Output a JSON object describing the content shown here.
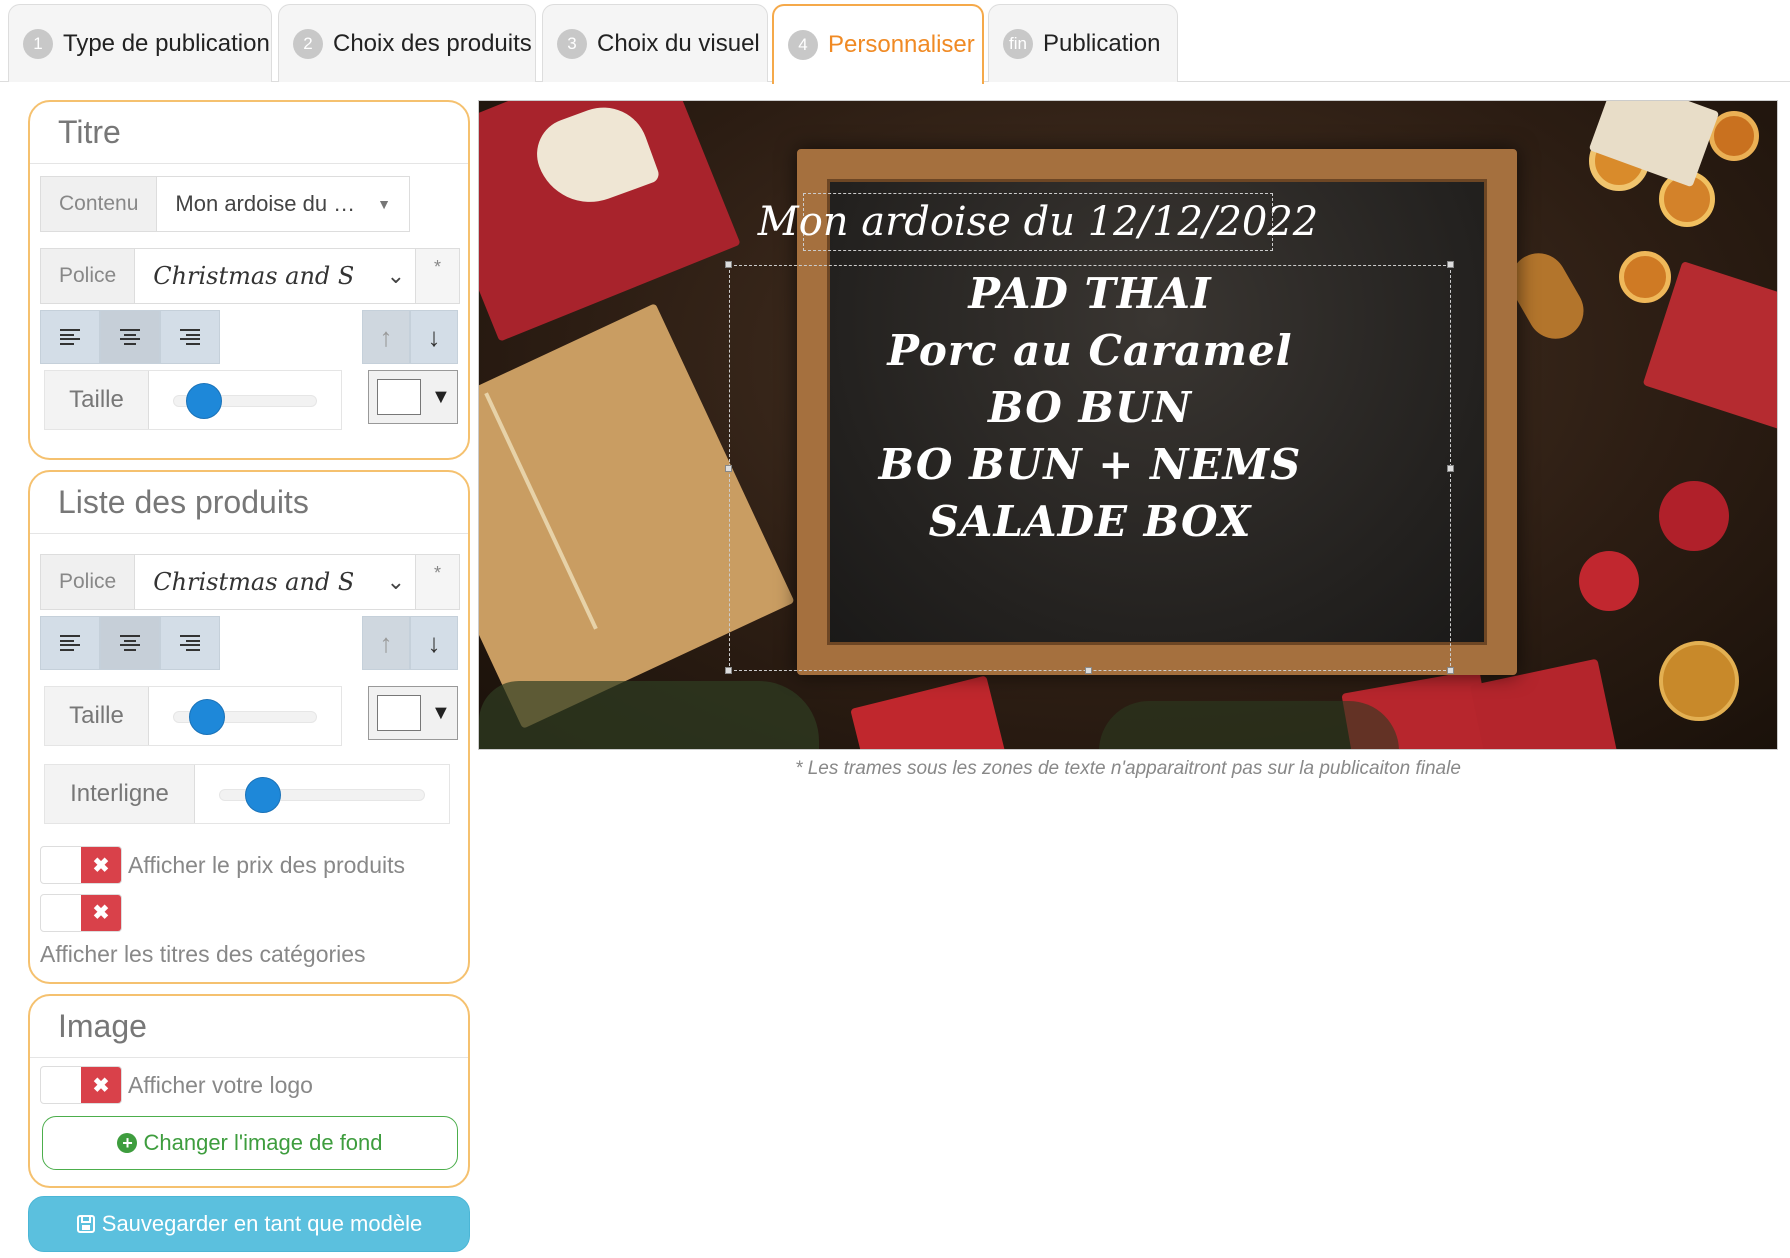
{
  "tabs": [
    {
      "num": "1",
      "label": "Type de publication"
    },
    {
      "num": "2",
      "label": "Choix des produits"
    },
    {
      "num": "3",
      "label": "Choix du visuel"
    },
    {
      "num": "4",
      "label": "Personnaliser",
      "active": true
    },
    {
      "num": "fin",
      "label": "Publication"
    }
  ],
  "titre": {
    "heading": "Titre",
    "contenu_label": "Contenu",
    "contenu_value": "Mon ardoise du …",
    "police_label": "Police",
    "police_value": "Christmas and Santa",
    "star": "*",
    "taille_label": "Taille",
    "taille_level": 0.12,
    "color": "#ffffff"
  },
  "liste": {
    "heading": "Liste des produits",
    "police_label": "Police",
    "police_value": "Christmas and Santa",
    "star": "*",
    "taille_label": "Taille",
    "taille_level": 0.15,
    "interligne_label": "Interligne",
    "interligne_level": 0.15,
    "color": "#ffffff",
    "toggle_prix": "Afficher le prix des produits",
    "toggle_titres": "Afficher les titres des catégories"
  },
  "image": {
    "heading": "Image",
    "toggle_logo": "Afficher votre logo",
    "change_bg": "Changer l'image de fond"
  },
  "save_label": "Sauvegarder en tant que modèle",
  "preview": {
    "title": "Mon ardoise du 12/12/2022",
    "items": [
      "PAD THAI",
      "Porc au Caramel",
      "BO BUN",
      "BO BUN + NEMS",
      "SALADE BOX"
    ]
  },
  "note": "* Les trames sous les zones de texte n'apparaitront pas sur la publicaiton finale",
  "icons": {
    "align_left": "align-left-icon",
    "align_center": "align-center-icon",
    "align_right": "align-right-icon",
    "arrow_up": "arrow-up-icon",
    "arrow_down": "arrow-down-icon",
    "toggle_off": "x-icon",
    "plus": "plus-circle-icon",
    "save": "floppy-disk-icon"
  },
  "colors": {
    "accent_orange": "#f08a24",
    "card_border": "#f5c16f",
    "toggle_off": "#d9414a",
    "slider": "#1e88d9",
    "save_button": "#5bc0de",
    "green": "#3e9d3e"
  }
}
